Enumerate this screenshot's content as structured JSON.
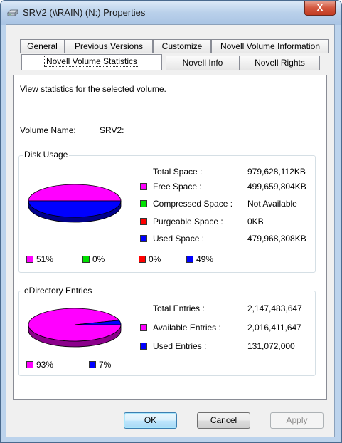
{
  "window": {
    "title": "SRV2 (\\\\RAIN) (N:) Properties",
    "close_label": "X"
  },
  "tabs_back": [
    "General",
    "Previous Versions",
    "Customize",
    "Novell Volume Information"
  ],
  "tabs_front": [
    "Novell Volume Statistics",
    "Novell Info",
    "Novell Rights"
  ],
  "active_tab": "Novell Volume Statistics",
  "panel": {
    "description": "View statistics for the selected volume.",
    "volume_name_label": "Volume Name:",
    "volume_name_value": "SRV2:"
  },
  "disk_usage": {
    "title": "Disk Usage",
    "rows": [
      {
        "label": "Total Space :",
        "value": "979,628,112KB"
      },
      {
        "label": "Free Space :",
        "value": "499,659,804KB",
        "color": "#ff00ff"
      },
      {
        "label": "Compressed Space :",
        "value": "Not Available",
        "color": "#00e000"
      },
      {
        "label": "Purgeable Space :",
        "value": "0KB",
        "color": "#ff0000"
      },
      {
        "label": "Used Space :",
        "value": "479,968,308KB",
        "color": "#0000ff"
      }
    ],
    "percentages": [
      {
        "label": "51%",
        "color": "#ff00ff"
      },
      {
        "label": "0%",
        "color": "#00e000"
      },
      {
        "label": "0%",
        "color": "#ff0000"
      },
      {
        "label": "49%",
        "color": "#0000ff"
      }
    ]
  },
  "edirectory": {
    "title": "eDirectory Entries",
    "rows": [
      {
        "label": "Total Entries :",
        "value": "2,147,483,647"
      },
      {
        "label": "Available Entries :",
        "value": "2,016,411,647",
        "color": "#ff00ff"
      },
      {
        "label": "Used Entries :",
        "value": "131,072,000",
        "color": "#0000ff"
      }
    ],
    "percentages": [
      {
        "label": "93%",
        "color": "#ff00ff"
      },
      {
        "label": "7%",
        "color": "#0000ff"
      }
    ]
  },
  "chart_data": [
    {
      "type": "pie",
      "categories": [
        "Free Space",
        "Compressed Space",
        "Purgeable Space",
        "Used Space"
      ],
      "values": [
        51,
        0,
        0,
        49
      ],
      "colors": [
        "#ff00ff",
        "#00e000",
        "#ff0000",
        "#0000ff"
      ]
    },
    {
      "type": "pie",
      "categories": [
        "Available Entries",
        "Used Entries"
      ],
      "values": [
        93,
        7
      ],
      "colors": [
        "#ff00ff",
        "#0000ff"
      ]
    }
  ],
  "buttons": {
    "ok": "OK",
    "cancel": "Cancel",
    "apply": "Apply"
  }
}
